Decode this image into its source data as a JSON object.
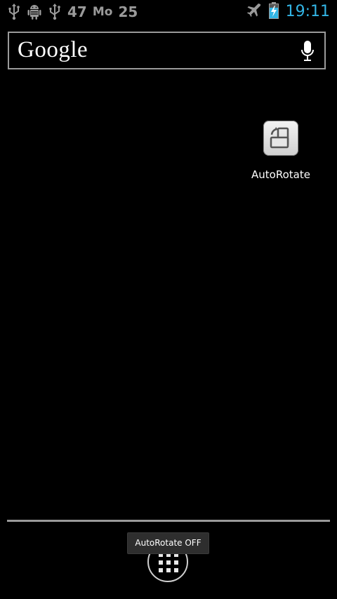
{
  "status_bar": {
    "left_icons": [
      "usb-icon",
      "android-debug-icon",
      "usb-icon"
    ],
    "signal_number": "47",
    "carrier_label": "Mo",
    "date_number": "25",
    "right_icons": [
      "airplane-mode-icon",
      "battery-charging-icon"
    ],
    "time": "19:11"
  },
  "search_bar": {
    "logo_text": "Google",
    "voice_icon": "mic-icon"
  },
  "home_shortcuts": [
    {
      "label": "AutoRotate",
      "icon": "auto-rotate-icon"
    }
  ],
  "dock": {
    "all_apps_icon": "all-apps-icon"
  },
  "toast": {
    "message": "AutoRotate OFF"
  },
  "colors": {
    "background": "#000000",
    "status_gray": "#9a9a9a",
    "clock_blue": "#33b5e5",
    "toast_bg": "#2e2e2e"
  }
}
